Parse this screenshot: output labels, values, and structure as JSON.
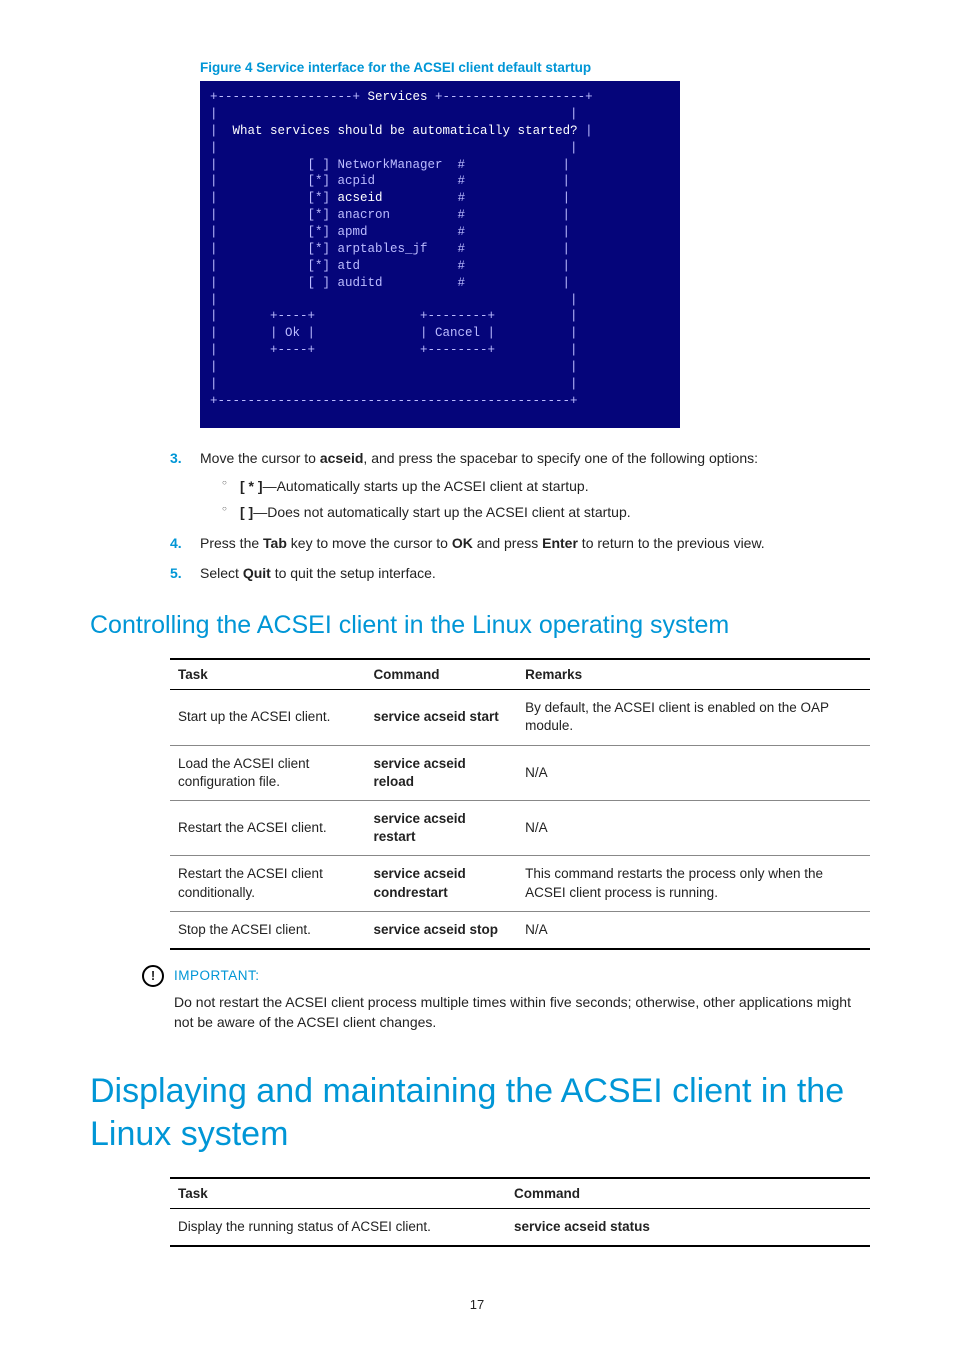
{
  "figureCaption": "Figure 4 Service interface for the ACSEI client default startup",
  "terminal": {
    "headerLeft": "+------------------+ ",
    "headerTitle": "Services",
    "headerRight": " +-------------------+",
    "prompt": "What services should be automatically started?",
    "rows": [
      {
        "mark": "[ ]",
        "name": "NetworkManager",
        "suf": "#"
      },
      {
        "mark": "[*]",
        "name": "acpid",
        "suf": "#"
      },
      {
        "mark": "[*]",
        "name": "acseid",
        "suf": "#",
        "hl": true
      },
      {
        "mark": "[*]",
        "name": "anacron",
        "suf": "#"
      },
      {
        "mark": "[*]",
        "name": "apmd",
        "suf": "#"
      },
      {
        "mark": "[*]",
        "name": "arptables_jf",
        "suf": "#"
      },
      {
        "mark": "[*]",
        "name": "atd",
        "suf": "#"
      },
      {
        "mark": "[ ]",
        "name": "auditd",
        "suf": "#"
      }
    ],
    "okBoxTop": "+----+",
    "okBoxMid": "| Ok |",
    "okBoxBot": "+----+",
    "cancelBoxTop": "+--------+",
    "cancelBoxMid": "| Cancel |",
    "cancelBoxBot": "+--------+",
    "footer": "+-----------------------------------------------+"
  },
  "steps": {
    "s3_pre": "Move the cursor to ",
    "s3_bold": "acseid",
    "s3_post": ", and press the spacebar to specify one of the following options:",
    "s3_a_bold": "[ * ]",
    "s3_a_text": "—Automatically starts up the ACSEI client at startup.",
    "s3_b_bold": "[   ]",
    "s3_b_text": "—Does not automatically start up the ACSEI client at startup.",
    "s4_a": "Press the ",
    "s4_b": "Tab",
    "s4_c": " key to move the cursor to ",
    "s4_d": "OK",
    "s4_e": " and press ",
    "s4_f": "Enter",
    "s4_g": " to return to the previous view.",
    "s5_a": "Select ",
    "s5_b": "Quit",
    "s5_c": " to quit the setup interface."
  },
  "h2": "Controlling the ACSEI client in the Linux operating system",
  "table1": {
    "h1": "Task",
    "h2": "Command",
    "h3": "Remarks",
    "rows": [
      {
        "task": "Start up the ACSEI client.",
        "cmd": "service acseid start",
        "rem": "By default, the ACSEI client is enabled on the OAP module."
      },
      {
        "task": "Load the ACSEI client configuration file.",
        "cmd": "service acseid reload",
        "rem": "N/A"
      },
      {
        "task": "Restart the ACSEI client.",
        "cmd": "service acseid restart",
        "rem": "N/A"
      },
      {
        "task": "Restart the ACSEI client conditionally.",
        "cmd": "service acseid condrestart",
        "rem": "This command restarts the process only when the ACSEI client process is running."
      },
      {
        "task": "Stop the ACSEI client.",
        "cmd": "service acseid stop",
        "rem": "N/A"
      }
    ]
  },
  "important": {
    "label": "IMPORTANT:",
    "body": "Do not restart the ACSEI client process multiple times within five seconds; otherwise, other applications might not be aware of the ACSEI client changes."
  },
  "h1": "Displaying and maintaining the ACSEI client in the Linux system",
  "table2": {
    "h1": "Task",
    "h2": "Command",
    "rows": [
      {
        "task": "Display the running status of ACSEI client.",
        "cmd": "service acseid status"
      }
    ]
  },
  "pageNum": "17"
}
